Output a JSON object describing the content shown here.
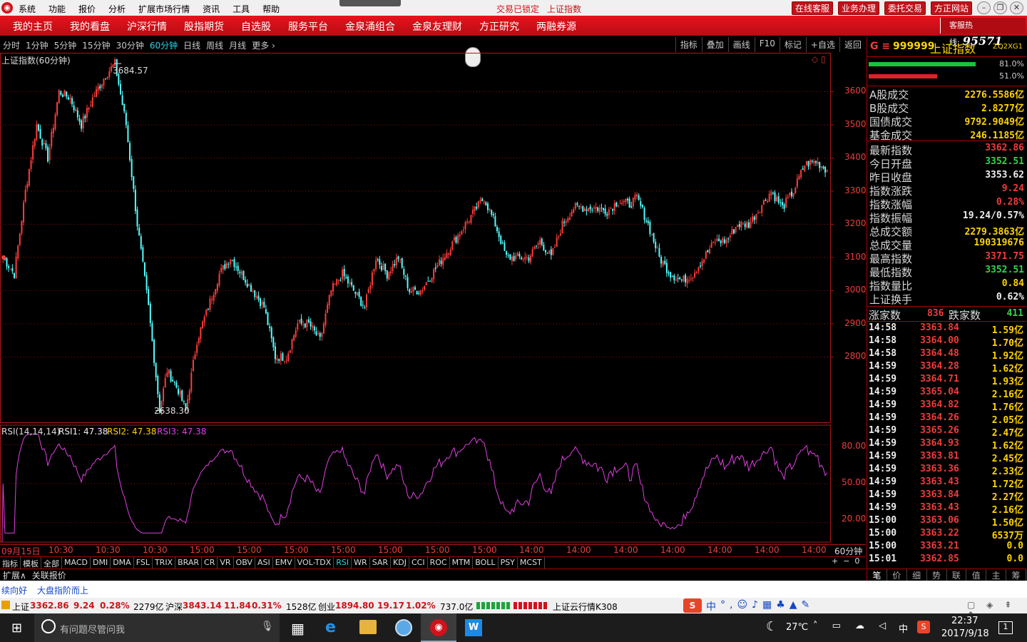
{
  "app": {
    "menus": [
      "系统",
      "功能",
      "报价",
      "分析",
      "扩展市场行情",
      "资讯",
      "工具",
      "帮助"
    ],
    "lock_status": "交易已锁定",
    "market_name": "上证指数",
    "right_buttons": [
      "在线客服",
      "业务办理",
      "委托交易",
      "方正网站"
    ]
  },
  "nav": {
    "items": [
      "我的主页",
      "我的看盘",
      "沪深行情",
      "股指期货",
      "自选股",
      "服务平台",
      "金泉涌组合",
      "金泉友理财",
      "方正研究",
      "两融券源"
    ],
    "hotline_label": "客服热线:",
    "hotline_number": "95571"
  },
  "toolbar": {
    "periods": [
      "分时",
      "1分钟",
      "5分钟",
      "15分钟",
      "30分钟",
      "60分钟",
      "日线",
      "周线",
      "月线",
      "更多 ›"
    ],
    "tools": [
      "指标",
      "叠加",
      "画线",
      "F10",
      "标记",
      "+自选",
      "返回"
    ]
  },
  "chart": {
    "title": "上证指数(60分钟)",
    "high_label": "3684.57",
    "low_label": "2638.30",
    "y_ticks": [
      "3600",
      "3500",
      "3400",
      "3300",
      "3200",
      "3100",
      "3000",
      "2900",
      "2800"
    ],
    "rsi_label": "RSI(14,14,14)",
    "rsi1": "RSI1: 47.38",
    "rsi2": "RSI2: 47.38",
    "rsi3": "RSI3: 47.38",
    "rsi_ticks": [
      "80.00",
      "50.00",
      "20.00"
    ],
    "x_labels": [
      "09月15日",
      "10:30",
      "10:30",
      "10:30",
      "15:00",
      "15:00",
      "15:00",
      "15:00",
      "15:00",
      "15:00",
      "15:00",
      "14:00",
      "14:00",
      "14:00",
      "14:00",
      "14:00",
      "14:00",
      "14:00"
    ],
    "period_badge": "60分钟",
    "indicator_tabs": [
      "指标",
      "模板",
      "全部",
      "MACD",
      "DMI",
      "DMA",
      "FSL",
      "TRIX",
      "BRAR",
      "CR",
      "VR",
      "OBV",
      "ASI",
      "EMV",
      "VOL-TDX",
      "RSI",
      "WR",
      "SAR",
      "KDJ",
      "CCI",
      "ROC",
      "MTM",
      "BOLL",
      "PSY",
      "MCST"
    ],
    "bottom_tabs": [
      "扩展∧",
      "关联报价"
    ]
  },
  "chart_data": {
    "type": "line",
    "title": "上证指数(60分钟)",
    "y_range": [
      2620,
      3700
    ],
    "anchors": [
      {
        "i": 0,
        "v": 3100
      },
      {
        "i": 6,
        "v": 3050
      },
      {
        "i": 12,
        "v": 3300
      },
      {
        "i": 18,
        "v": 3500
      },
      {
        "i": 24,
        "v": 3400
      },
      {
        "i": 30,
        "v": 3600
      },
      {
        "i": 36,
        "v": 3580
      },
      {
        "i": 42,
        "v": 3500
      },
      {
        "i": 48,
        "v": 3580
      },
      {
        "i": 55,
        "v": 3650
      },
      {
        "i": 60,
        "v": 3684.57
      },
      {
        "i": 66,
        "v": 3500
      },
      {
        "i": 72,
        "v": 3200
      },
      {
        "i": 78,
        "v": 2950
      },
      {
        "i": 84,
        "v": 2640
      },
      {
        "i": 88,
        "v": 2760
      },
      {
        "i": 94,
        "v": 2700
      },
      {
        "i": 98,
        "v": 2638.3
      },
      {
        "i": 104,
        "v": 2850
      },
      {
        "i": 110,
        "v": 2950
      },
      {
        "i": 116,
        "v": 3050
      },
      {
        "i": 122,
        "v": 3100
      },
      {
        "i": 128,
        "v": 3050
      },
      {
        "i": 134,
        "v": 3000
      },
      {
        "i": 140,
        "v": 2950
      },
      {
        "i": 146,
        "v": 2800
      },
      {
        "i": 152,
        "v": 2800
      },
      {
        "i": 158,
        "v": 2900
      },
      {
        "i": 164,
        "v": 2900
      },
      {
        "i": 170,
        "v": 2850
      },
      {
        "i": 176,
        "v": 3000
      },
      {
        "i": 182,
        "v": 3050
      },
      {
        "i": 188,
        "v": 3000
      },
      {
        "i": 194,
        "v": 2950
      },
      {
        "i": 200,
        "v": 3100
      },
      {
        "i": 206,
        "v": 3050
      },
      {
        "i": 212,
        "v": 3100
      },
      {
        "i": 218,
        "v": 3000
      },
      {
        "i": 224,
        "v": 3000
      },
      {
        "i": 230,
        "v": 3050
      },
      {
        "i": 236,
        "v": 3100
      },
      {
        "i": 242,
        "v": 3150
      },
      {
        "i": 248,
        "v": 3200
      },
      {
        "i": 254,
        "v": 3250
      },
      {
        "i": 258,
        "v": 3280
      },
      {
        "i": 264,
        "v": 3200
      },
      {
        "i": 270,
        "v": 3100
      },
      {
        "i": 276,
        "v": 3100
      },
      {
        "i": 282,
        "v": 3100
      },
      {
        "i": 288,
        "v": 3150
      },
      {
        "i": 294,
        "v": 3100
      },
      {
        "i": 300,
        "v": 3200
      },
      {
        "i": 306,
        "v": 3250
      },
      {
        "i": 312,
        "v": 3250
      },
      {
        "i": 318,
        "v": 3250
      },
      {
        "i": 324,
        "v": 3240
      },
      {
        "i": 330,
        "v": 3270
      },
      {
        "i": 336,
        "v": 3260
      },
      {
        "i": 340,
        "v": 3280
      },
      {
        "i": 346,
        "v": 3200
      },
      {
        "i": 352,
        "v": 3100
      },
      {
        "i": 358,
        "v": 3050
      },
      {
        "i": 364,
        "v": 3030
      },
      {
        "i": 370,
        "v": 3050
      },
      {
        "i": 376,
        "v": 3100
      },
      {
        "i": 382,
        "v": 3150
      },
      {
        "i": 388,
        "v": 3150
      },
      {
        "i": 394,
        "v": 3200
      },
      {
        "i": 400,
        "v": 3200
      },
      {
        "i": 406,
        "v": 3250
      },
      {
        "i": 412,
        "v": 3300
      },
      {
        "i": 418,
        "v": 3250
      },
      {
        "i": 424,
        "v": 3300
      },
      {
        "i": 430,
        "v": 3380
      },
      {
        "i": 436,
        "v": 3390
      },
      {
        "i": 442,
        "v": 3362.86
      }
    ]
  },
  "right": {
    "code": "999999",
    "name": "上证指数",
    "tag": "ZQ2XG1",
    "bars": [
      "81.0%",
      "51.0%"
    ],
    "vol_rows": [
      {
        "k": "A股成交",
        "v": "2276.5586亿"
      },
      {
        "k": "B股成交",
        "v": "2.8277亿"
      },
      {
        "k": "国债成交",
        "v": "9792.9049亿"
      },
      {
        "k": "基金成交",
        "v": "246.1185亿"
      }
    ],
    "quote_rows": [
      {
        "k": "最新指数",
        "v": "3362.86",
        "c": "#f03c3c"
      },
      {
        "k": "今日开盘",
        "v": "3352.51",
        "c": "#2cd84a"
      },
      {
        "k": "昨日收盘",
        "v": "3353.62",
        "c": "#eeeeee"
      },
      {
        "k": "指数涨跌",
        "v": "9.24",
        "c": "#f03c3c"
      },
      {
        "k": "指数涨幅",
        "v": "0.28%",
        "c": "#f03c3c"
      },
      {
        "k": "指数振幅",
        "v": "19.24/0.57%",
        "c": "#eeeeee"
      },
      {
        "k": "总成交额",
        "v": "2279.3863亿",
        "c": "#ffd400"
      },
      {
        "k": "总成交量",
        "v": "190319676",
        "c": "#ffd400"
      },
      {
        "k": "最高指数",
        "v": "3371.75",
        "c": "#f03c3c"
      },
      {
        "k": "最低指数",
        "v": "3352.51",
        "c": "#2cd84a"
      },
      {
        "k": "指数量比",
        "v": "0.84",
        "c": "#ffd400"
      },
      {
        "k": "上证换手",
        "v": "0.62%",
        "c": "#eeeeee"
      }
    ],
    "up_label": "涨家数",
    "up_count": "836",
    "down_label": "跌家数",
    "down_count": "411",
    "ticks": [
      {
        "t": "14:58",
        "p": "3363.84",
        "a": "1.59亿"
      },
      {
        "t": "14:58",
        "p": "3364.00",
        "a": "1.70亿"
      },
      {
        "t": "14:58",
        "p": "3364.48",
        "a": "1.92亿"
      },
      {
        "t": "14:59",
        "p": "3364.28",
        "a": "1.62亿"
      },
      {
        "t": "14:59",
        "p": "3364.71",
        "a": "1.93亿"
      },
      {
        "t": "14:59",
        "p": "3365.04",
        "a": "2.16亿"
      },
      {
        "t": "14:59",
        "p": "3364.82",
        "a": "1.76亿"
      },
      {
        "t": "14:59",
        "p": "3364.26",
        "a": "2.05亿"
      },
      {
        "t": "14:59",
        "p": "3365.26",
        "a": "2.47亿"
      },
      {
        "t": "14:59",
        "p": "3364.93",
        "a": "1.62亿"
      },
      {
        "t": "14:59",
        "p": "3363.81",
        "a": "2.45亿"
      },
      {
        "t": "14:59",
        "p": "3363.36",
        "a": "2.33亿"
      },
      {
        "t": "14:59",
        "p": "3363.43",
        "a": "1.72亿"
      },
      {
        "t": "14:59",
        "p": "3363.84",
        "a": "2.27亿"
      },
      {
        "t": "14:59",
        "p": "3363.43",
        "a": "2.16亿"
      },
      {
        "t": "15:00",
        "p": "3363.06",
        "a": "1.50亿"
      },
      {
        "t": "15:00",
        "p": "3363.22",
        "a": "6537万"
      },
      {
        "t": "15:00",
        "p": "3363.21",
        "a": "0.0"
      },
      {
        "t": "15:01",
        "p": "3362.85",
        "a": "0.0"
      }
    ],
    "tabs": [
      "笔",
      "价",
      "细",
      "势",
      "联",
      "值",
      "主",
      "筹"
    ]
  },
  "status": {
    "news1": "续向好",
    "news2": "大盘指阶而上"
  },
  "ticker": {
    "sh_label": "上证",
    "sh_val": "3362.86",
    "sh_chg": "9.24",
    "sh_pct": "0.28%",
    "sh_amt": "2279亿",
    "hs_label": "沪深",
    "hs_val": "3843.14",
    "hs_chg": "11.84",
    "hs_pct": "0.31%",
    "hs_amt": "1528亿",
    "cy_label": "创业",
    "cy_val": "1894.80",
    "cy_chg": "19.17",
    "cy_pct": "1.02%",
    "cy_amt": "737.0亿",
    "cloud": "上证云行情K308",
    "ime": "中"
  },
  "taskbar": {
    "search_placeholder": "有问题尽管问我",
    "weather": "27℃",
    "ime": "中",
    "time": "22:37",
    "date": "2017/9/18",
    "notif": "1"
  }
}
